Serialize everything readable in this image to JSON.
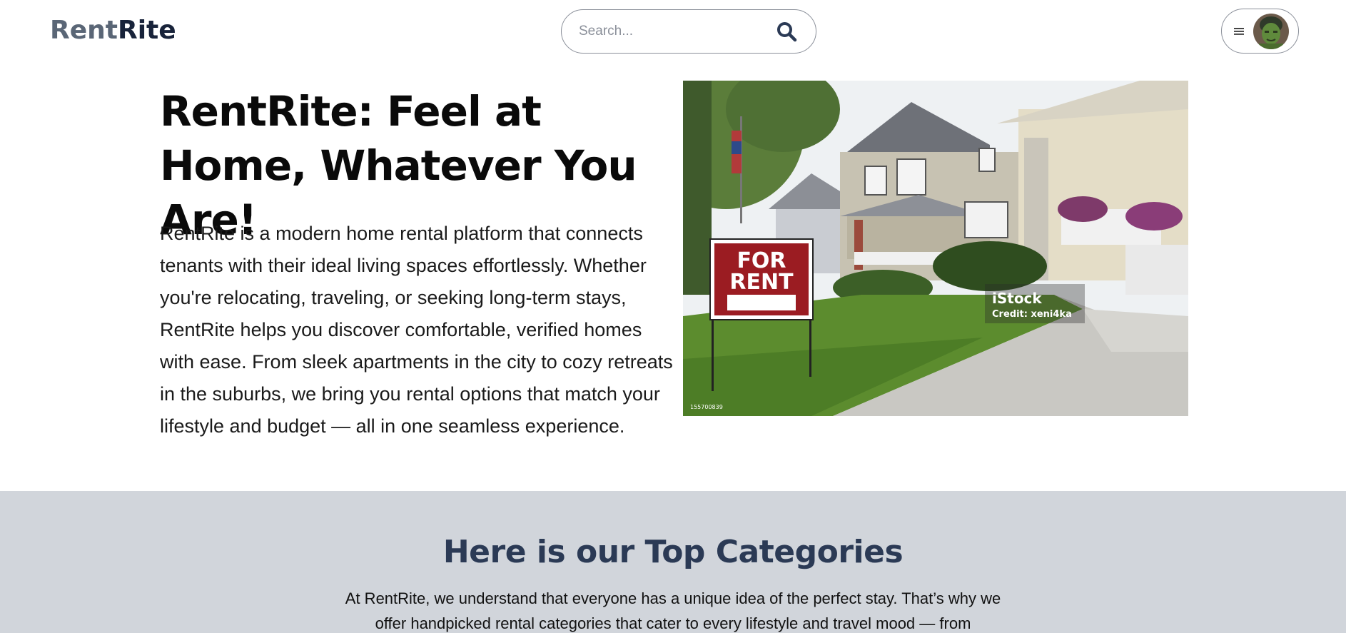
{
  "header": {
    "logo_part1": "Rent",
    "logo_part2": "Rite",
    "search": {
      "placeholder": "Search...",
      "value": ""
    },
    "icons": {
      "search": "search-icon",
      "menu": "hamburger-menu-icon",
      "avatar": "user-avatar"
    }
  },
  "hero": {
    "title": "RentRite: Feel at Home, Whatever You Are!",
    "description": "RentRite is a modern home rental platform that connects tenants with their ideal living spaces effortlessly. Whether you're relocating, traveling, or seeking long-term stays, RentRite helps you discover comfortable, verified homes with ease. From sleek apartments in the city to cozy retreats in the suburbs, we bring you rental options that match your lifestyle and budget — all in one seamless experience.",
    "image": {
      "sign_line1": "FOR",
      "sign_line2": "RENT",
      "watermark_brand": "iStock",
      "watermark_credit": "Credit: xeni4ka",
      "image_code": "155700839"
    }
  },
  "categories": {
    "title": "Here is our Top Categories",
    "description": "At RentRite, we understand that everyone has a unique idea of the perfect stay. That’s why we offer handpicked rental categories that cater to every lifestyle and travel mood — from"
  },
  "colors": {
    "logo_light": "#5a6676",
    "logo_dark": "#18233a",
    "section_bg": "#d1d5db",
    "section_title": "#2b3a55",
    "sign_red": "#9b1c22"
  }
}
